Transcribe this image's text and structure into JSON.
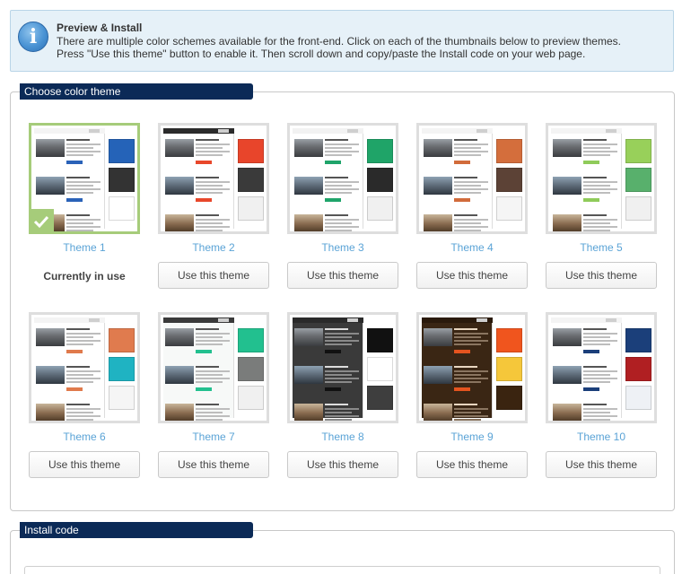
{
  "info": {
    "icon": "info-icon",
    "title": "Preview & Install",
    "line1": "There are multiple color schemes available for the front-end. Click on each of the thumbnails below to preview themes.",
    "line2": "Press \"Use this theme\" button to enable it. Then scroll down and copy/paste the Install code on your web page."
  },
  "theme_section": {
    "title": "Choose color theme",
    "current_label": "Currently in use",
    "button_label": "Use this theme",
    "themes": [
      {
        "label": "Theme 1",
        "selected": true,
        "bg": "#ffffff",
        "bar": "#f4f4f4",
        "text": "#bdbdbd",
        "heading": "#555555",
        "cta": "#2a62b8",
        "swatches": [
          "#2563b8",
          "#333333",
          "#ffffff"
        ]
      },
      {
        "label": "Theme 2",
        "selected": false,
        "bg": "#ffffff",
        "bar": "#2b2b2b",
        "text": "#bdbdbd",
        "heading": "#555555",
        "cta": "#e8472b",
        "swatches": [
          "#e8452b",
          "#3a3a3a",
          "#f0f0f0"
        ]
      },
      {
        "label": "Theme 3",
        "selected": false,
        "bg": "#ffffff",
        "bar": "#f2f2f2",
        "text": "#bdbdbd",
        "heading": "#555555",
        "cta": "#1fa46a",
        "swatches": [
          "#1fa468",
          "#2a2a2a",
          "#f0f0f0"
        ]
      },
      {
        "label": "Theme 4",
        "selected": false,
        "bg": "#ffffff",
        "bar": "#f4f4f4",
        "text": "#bdbdbd",
        "heading": "#555555",
        "cta": "#d16b3b",
        "swatches": [
          "#d46e3c",
          "#5c4236",
          "#f5f5f5"
        ]
      },
      {
        "label": "Theme 5",
        "selected": false,
        "bg": "#ffffff",
        "bar": "#f4f4f4",
        "text": "#bdbdbd",
        "heading": "#555555",
        "cta": "#8fcb5a",
        "swatches": [
          "#98d05a",
          "#58b06c",
          "#f0f0f0"
        ]
      },
      {
        "label": "Theme 6",
        "selected": false,
        "bg": "#ffffff",
        "bar": "#f4f4f4",
        "text": "#bdbdbd",
        "heading": "#555555",
        "cta": "#e07a4c",
        "swatches": [
          "#e07b4e",
          "#1fb3c2",
          "#f5f5f5"
        ]
      },
      {
        "label": "Theme 7",
        "selected": false,
        "bg": "#f7f9f8",
        "bar": "#3a3a3a",
        "text": "#bdbdbd",
        "heading": "#555555",
        "cta": "#23c08f",
        "swatches": [
          "#22c08f",
          "#7a7c7b",
          "#f0f0f0"
        ]
      },
      {
        "label": "Theme 8",
        "selected": false,
        "bg": "#3a3a3a",
        "bar": "#2a2a2a",
        "text": "#8a8a8a",
        "heading": "#dddddd",
        "cta": "#111111",
        "swatches": [
          "#111111",
          "#ffffff",
          "#3e3e3e"
        ]
      },
      {
        "label": "Theme 9",
        "selected": false,
        "bg": "#3a2614",
        "bar": "#2a1a0c",
        "text": "#8a7560",
        "heading": "#e8d6c0",
        "cta": "#e4541f",
        "swatches": [
          "#f0551e",
          "#f5c73a",
          "#3a2410"
        ]
      },
      {
        "label": "Theme 10",
        "selected": false,
        "bg": "#ffffff",
        "bar": "#f4f4f4",
        "text": "#bdbdbd",
        "heading": "#555555",
        "cta": "#1b3f7a",
        "swatches": [
          "#1b3f7a",
          "#b01f22",
          "#eef1f5"
        ]
      }
    ]
  },
  "install_section": {
    "title": "Install code"
  }
}
